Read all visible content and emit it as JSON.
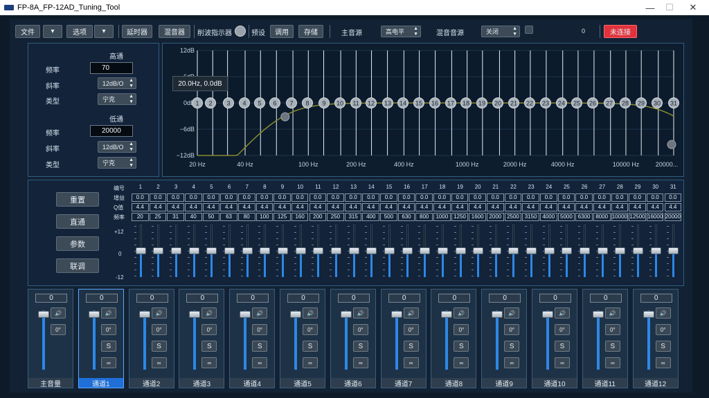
{
  "window": {
    "title": "FP-8A_FP-12AD_Tuning_Tool",
    "controls": [
      "—",
      "☐",
      "✕"
    ]
  },
  "toolbar": {
    "file": "文件",
    "options": "选项",
    "delay": "延时器",
    "mixer": "混音器",
    "clip_indicator": "削波指示器",
    "preset": "预设",
    "recall": "调用",
    "store": "存储",
    "main_source_label": "主音源",
    "main_source_value": "高电平",
    "mix_source_label": "混音音源",
    "mix_source_value": "关闭",
    "counter": "0",
    "connect": "未连接"
  },
  "filters": {
    "hp_title": "高通",
    "freq_label": "频率",
    "hp_freq": "70",
    "slope_label": "斜率",
    "hp_slope": "12dB/O",
    "type_label": "类型",
    "hp_type": "宁克",
    "lp_title": "低通",
    "lp_freq": "20000",
    "lp_slope": "12dB/O",
    "lp_type": "宁克"
  },
  "graph": {
    "tooltip": "20.0Hz, 0.0dB",
    "y_labels": [
      "12dB",
      "6dB",
      "0dB",
      "−6dB",
      "−12dB"
    ],
    "x_labels": [
      "20 Hz",
      "40 Hz",
      "100 Hz",
      "200 Hz",
      "400 Hz",
      "1000 Hz",
      "2000 Hz",
      "4000 Hz",
      "10000 Hz",
      "20000..."
    ],
    "nodes": [
      "1",
      "2",
      "3",
      "4",
      "5",
      "6",
      "7",
      "8",
      "9",
      "10",
      "11",
      "12",
      "13",
      "14",
      "15",
      "16",
      "17",
      "18",
      "19",
      "20",
      "21",
      "22",
      "23",
      "24",
      "25",
      "26",
      "27",
      "28",
      "29",
      "30",
      "31"
    ]
  },
  "eq": {
    "buttons": [
      "重置",
      "直通",
      "参数",
      "联调"
    ],
    "row_labels": [
      "编号",
      "增益",
      "Q值",
      "频率"
    ],
    "scale": [
      "+12",
      "0",
      "-12"
    ],
    "gains": [
      "0.0",
      "0.0",
      "0.0",
      "0.0",
      "0.0",
      "0.0",
      "0.0",
      "0.0",
      "0.0",
      "0.0",
      "0.0",
      "0.0",
      "0.0",
      "0.0",
      "0.0",
      "0.0",
      "0.0",
      "0.0",
      "0.0",
      "0.0",
      "0.0",
      "0.0",
      "0.0",
      "0.0",
      "0.0",
      "0.0",
      "0.0",
      "0.0",
      "0.0",
      "0.0",
      "0.0"
    ],
    "q": [
      "4.4",
      "4.4",
      "4.4",
      "4.4",
      "4.4",
      "4.4",
      "4.4",
      "4.4",
      "4.4",
      "4.4",
      "4.4",
      "4.4",
      "4.4",
      "4.4",
      "4.4",
      "4.4",
      "4.4",
      "4.4",
      "4.4",
      "4.4",
      "4.4",
      "4.4",
      "4.4",
      "4.4",
      "4.4",
      "4.4",
      "4.4",
      "4.4",
      "4.4",
      "4.4",
      "4.4"
    ],
    "freqs": [
      "20",
      "25",
      "31",
      "40",
      "50",
      "63",
      "80",
      "100",
      "125",
      "160",
      "200",
      "250",
      "315",
      "400",
      "500",
      "630",
      "800",
      "1000",
      "1250",
      "1600",
      "2000",
      "2500",
      "3150",
      "4000",
      "5000",
      "6300",
      "8000",
      "10000",
      "12500",
      "16000",
      "20000"
    ],
    "gain_values_db": [
      0,
      0,
      0,
      0,
      0,
      0,
      0,
      0,
      0,
      0,
      0,
      0,
      0,
      0,
      0,
      0,
      0,
      0,
      0,
      0,
      0,
      0,
      0,
      0,
      0,
      0,
      0,
      0,
      0,
      0,
      0
    ]
  },
  "channels": [
    {
      "name": "主音量",
      "value": "0",
      "phase": "0°",
      "solo": "S"
    },
    {
      "name": "通道1",
      "value": "0",
      "phase": "0°",
      "solo": "S"
    },
    {
      "name": "通道2",
      "value": "0",
      "phase": "0°",
      "solo": "S"
    },
    {
      "name": "通道3",
      "value": "0",
      "phase": "0°",
      "solo": "S"
    },
    {
      "name": "通道4",
      "value": "0",
      "phase": "0°",
      "solo": "S"
    },
    {
      "name": "通道5",
      "value": "0",
      "phase": "0°",
      "solo": "S"
    },
    {
      "name": "通道6",
      "value": "0",
      "phase": "0°",
      "solo": "S"
    },
    {
      "name": "通道7",
      "value": "0",
      "phase": "0°",
      "solo": "S"
    },
    {
      "name": "通道8",
      "value": "0",
      "phase": "0°",
      "solo": "S"
    },
    {
      "name": "通道9",
      "value": "0",
      "phase": "0°",
      "solo": "S"
    },
    {
      "name": "通道10",
      "value": "0",
      "phase": "0°",
      "solo": "S"
    },
    {
      "name": "通道11",
      "value": "0",
      "phase": "0°",
      "solo": "S"
    },
    {
      "name": "通道12",
      "value": "0",
      "phase": "0°",
      "solo": "S"
    }
  ],
  "colors": {
    "accent": "#2c88e6",
    "connect": "#e0333c",
    "curve": "#8a8a2e"
  }
}
